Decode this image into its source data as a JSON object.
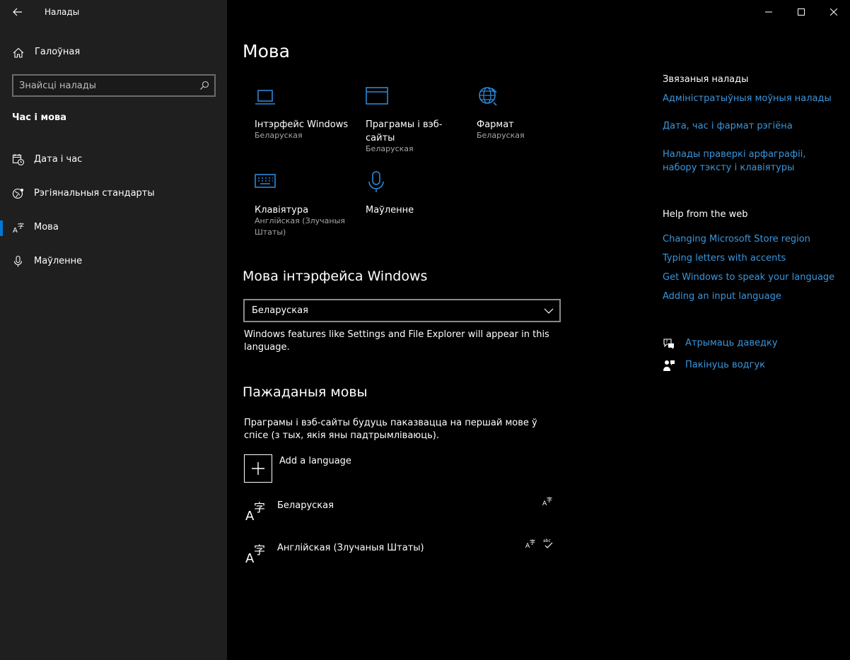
{
  "window": {
    "title": "Налады"
  },
  "sidebar": {
    "home_label": "Галоўная",
    "search_placeholder": "Знайсці налады",
    "section_title": "Час і мова",
    "items": [
      {
        "label": "Дата і час",
        "icon": "calendar-clock-icon"
      },
      {
        "label": "Рэгіянальныя стандарты",
        "icon": "region-icon"
      },
      {
        "label": "Мова",
        "icon": "language-icon",
        "active": true
      },
      {
        "label": "Маўленне",
        "icon": "microphone-icon"
      }
    ]
  },
  "main": {
    "title": "Мова",
    "tiles": [
      {
        "name": "Інтэрфейс Windows",
        "sub": "Беларуская",
        "icon": "laptop-icon"
      },
      {
        "name": "Праграмы і вэб-сайты",
        "sub": "Беларуская",
        "icon": "window-icon"
      },
      {
        "name": "Фармат",
        "sub": "Беларуская",
        "icon": "globe-icon"
      },
      {
        "name": "Клавіятура",
        "sub": "Англійская (Злучаныя Штаты)",
        "icon": "keyboard-icon"
      },
      {
        "name": "Маўленне",
        "sub": "",
        "icon": "microphone-icon"
      }
    ],
    "display_language": {
      "heading": "Мова інтэрфейса Windows",
      "selected": "Беларуская",
      "description": "Windows features like Settings and File Explorer will appear in this language."
    },
    "preferred": {
      "heading": "Пажаданыя мовы",
      "description": "Праграмы і вэб-сайты будуць паказвацца на першай мове ў спісе (з тых, якія яны падтрымліваюць).",
      "add_label": "Add a language",
      "languages": [
        {
          "name": "Беларуская",
          "features": [
            "display-language-icon"
          ]
        },
        {
          "name": "Англійская (Злучаныя Штаты)",
          "features": [
            "display-language-icon",
            "spellcheck-icon"
          ]
        }
      ]
    }
  },
  "right": {
    "related_heading": "Звязаныя налады",
    "related_links": [
      "Адміністратыўныя моўныя налады",
      "Дата, час і фармат рэгіёна",
      "Налады праверкі арфаграфіі, набору тэксту і клавіятуры"
    ],
    "help_heading": "Help from the web",
    "help_links": [
      "Changing Microsoft Store region",
      "Typing letters with accents",
      "Get Windows to speak your language",
      "Adding an input language"
    ],
    "actions": [
      {
        "label": "Атрымаць даведку",
        "icon": "help-chat-icon"
      },
      {
        "label": "Пакінуць водгук",
        "icon": "feedback-icon"
      }
    ]
  },
  "colors": {
    "accent": "#0078d7",
    "link": "#3a96dd",
    "icon_blue": "#2b88d8"
  }
}
